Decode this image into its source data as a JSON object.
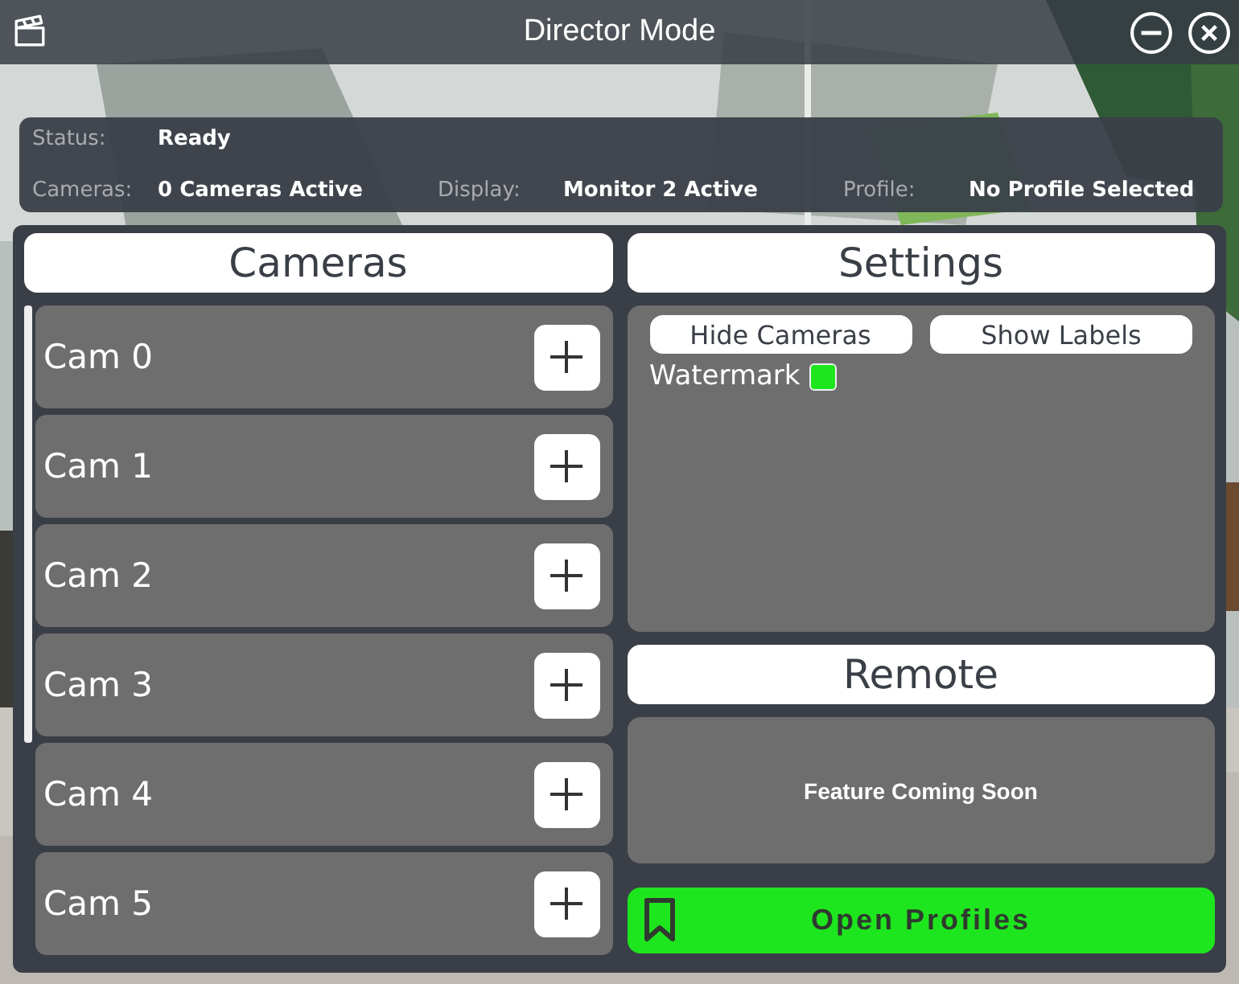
{
  "window": {
    "title": "Director Mode"
  },
  "info": {
    "rows": [
      [
        {
          "label": "Status:",
          "value": "Ready"
        }
      ],
      [
        {
          "label": "Cameras:",
          "value": "0 Cameras Active"
        },
        {
          "label": "Display:",
          "value": "Monitor 2 Active"
        },
        {
          "label": "Profile:",
          "value": "No Profile Selected"
        }
      ]
    ]
  },
  "cameras": {
    "title": "Cameras",
    "items": [
      {
        "label": "Cam 0"
      },
      {
        "label": "Cam 1"
      },
      {
        "label": "Cam 2"
      },
      {
        "label": "Cam 3"
      },
      {
        "label": "Cam 4"
      },
      {
        "label": "Cam 5"
      }
    ]
  },
  "settings": {
    "title": "Settings",
    "buttons": [
      "Hide Cameras",
      "Show Labels"
    ],
    "toggles": [
      {
        "label": "Watermark",
        "checked": true
      }
    ]
  },
  "remote": {
    "title": "Remote",
    "message": "Feature Coming Soon"
  },
  "profiles_button": "Open Profiles"
}
